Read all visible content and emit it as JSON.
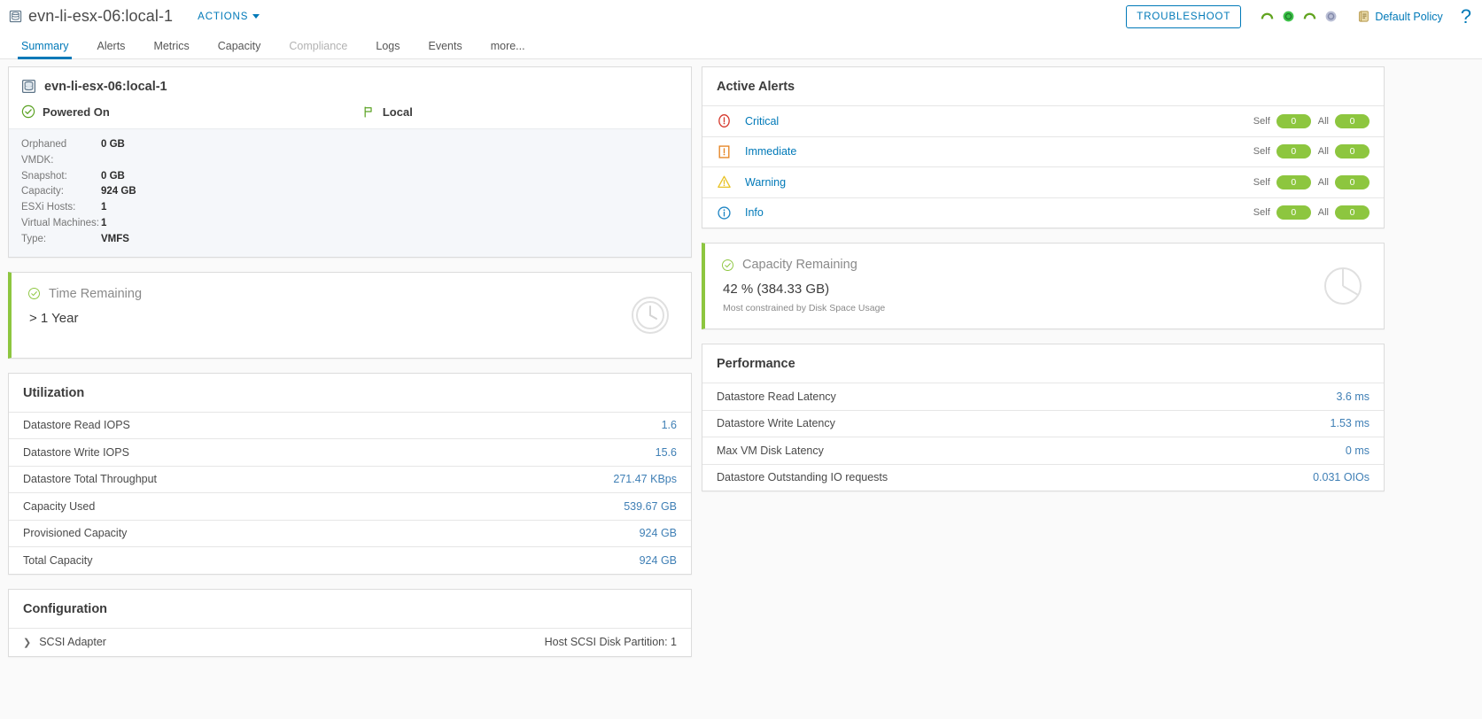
{
  "header": {
    "object_icon": "datastore-icon",
    "object_title": "evn-li-esx-06:local-1",
    "actions_label": "ACTIONS",
    "troubleshoot_label": "TROUBLESHOOT",
    "policy_label": "Default Policy",
    "help_label": "?",
    "badges": [
      {
        "name": "health-badge",
        "state": "green-arc"
      },
      {
        "name": "risk-badge",
        "state": "green-circle"
      },
      {
        "name": "efficiency-badge",
        "state": "green-arc"
      },
      {
        "name": "compliance-badge",
        "state": "grey-circle"
      }
    ]
  },
  "tabs": [
    {
      "label": "Summary",
      "active": true,
      "disabled": false
    },
    {
      "label": "Alerts",
      "active": false,
      "disabled": false
    },
    {
      "label": "Metrics",
      "active": false,
      "disabled": false
    },
    {
      "label": "Capacity",
      "active": false,
      "disabled": false
    },
    {
      "label": "Compliance",
      "active": false,
      "disabled": true
    },
    {
      "label": "Logs",
      "active": false,
      "disabled": false
    },
    {
      "label": "Events",
      "active": false,
      "disabled": false
    },
    {
      "label": "more...",
      "active": false,
      "disabled": false
    }
  ],
  "object_summary": {
    "title": "evn-li-esx-06:local-1",
    "power_state": "Powered On",
    "location": "Local",
    "details": [
      {
        "key": "Orphaned VMDK:",
        "value": "0 GB"
      },
      {
        "key": "Snapshot:",
        "value": "0 GB"
      },
      {
        "key": "Capacity:",
        "value": "924 GB"
      },
      {
        "key": "ESXi Hosts:",
        "value": "1"
      },
      {
        "key": "Virtual Machines:",
        "value": "1"
      },
      {
        "key": "Type:",
        "value": "VMFS"
      }
    ]
  },
  "active_alerts": {
    "title": "Active Alerts",
    "self_label": "Self",
    "all_label": "All",
    "rows": [
      {
        "icon": "critical-icon",
        "label": "Critical",
        "self": "0",
        "all": "0"
      },
      {
        "icon": "immediate-icon",
        "label": "Immediate",
        "self": "0",
        "all": "0"
      },
      {
        "icon": "warning-icon",
        "label": "Warning",
        "self": "0",
        "all": "0"
      },
      {
        "icon": "info-icon",
        "label": "Info",
        "self": "0",
        "all": "0"
      }
    ]
  },
  "time_remaining": {
    "title": "Time Remaining",
    "value": "> 1 Year",
    "status_color": "#8dc63f"
  },
  "capacity_remaining": {
    "title": "Capacity Remaining",
    "value": "42 % (384.33 GB)",
    "subtext": "Most constrained by Disk Space Usage",
    "status_color": "#8dc63f"
  },
  "utilization": {
    "title": "Utilization",
    "rows": [
      {
        "label": "Datastore Read IOPS",
        "value": "1.6"
      },
      {
        "label": "Datastore Write IOPS",
        "value": "15.6"
      },
      {
        "label": "Datastore Total Throughput",
        "value": "271.47 KBps"
      },
      {
        "label": "Capacity Used",
        "value": "539.67 GB"
      },
      {
        "label": "Provisioned Capacity",
        "value": "924 GB"
      },
      {
        "label": "Total Capacity",
        "value": "924 GB"
      }
    ]
  },
  "performance": {
    "title": "Performance",
    "rows": [
      {
        "label": "Datastore Read Latency",
        "value": "3.6 ms"
      },
      {
        "label": "Datastore Write Latency",
        "value": "1.53 ms"
      },
      {
        "label": "Max VM Disk Latency",
        "value": "0 ms"
      },
      {
        "label": "Datastore Outstanding IO requests",
        "value": "0.031 OIOs"
      }
    ]
  },
  "configuration": {
    "title": "Configuration",
    "rows": [
      {
        "label": "SCSI Adapter",
        "value": "Host SCSI Disk Partition: 1"
      }
    ]
  }
}
